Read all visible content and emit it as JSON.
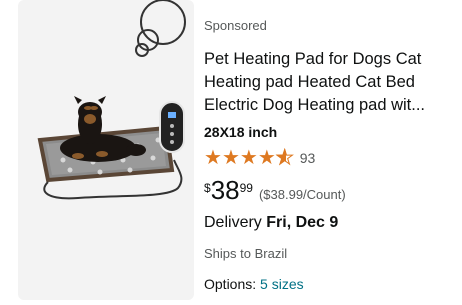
{
  "product": {
    "sponsored_label": "Sponsored",
    "title": "Pet Heating Pad for Dogs Cat Heating pad Heated Cat Bed Electric Dog Heating pad wit...",
    "size": "28X18 inch",
    "rating": {
      "value": 4.5,
      "max": 5,
      "count": "93"
    },
    "price": {
      "symbol": "$",
      "whole": "38",
      "fraction": "99",
      "unit_price": "($38.99/Count)"
    },
    "delivery": {
      "prefix": "Delivery",
      "date": "Fri, Dec 9"
    },
    "ships_to": "Ships to Brazil",
    "options": {
      "label": "Options:",
      "value": "5 sizes"
    },
    "image": {
      "icon": "product-image"
    }
  },
  "colors": {
    "star": "#de7921",
    "link": "#007185",
    "muted": "#565959",
    "text": "#0f1111"
  }
}
